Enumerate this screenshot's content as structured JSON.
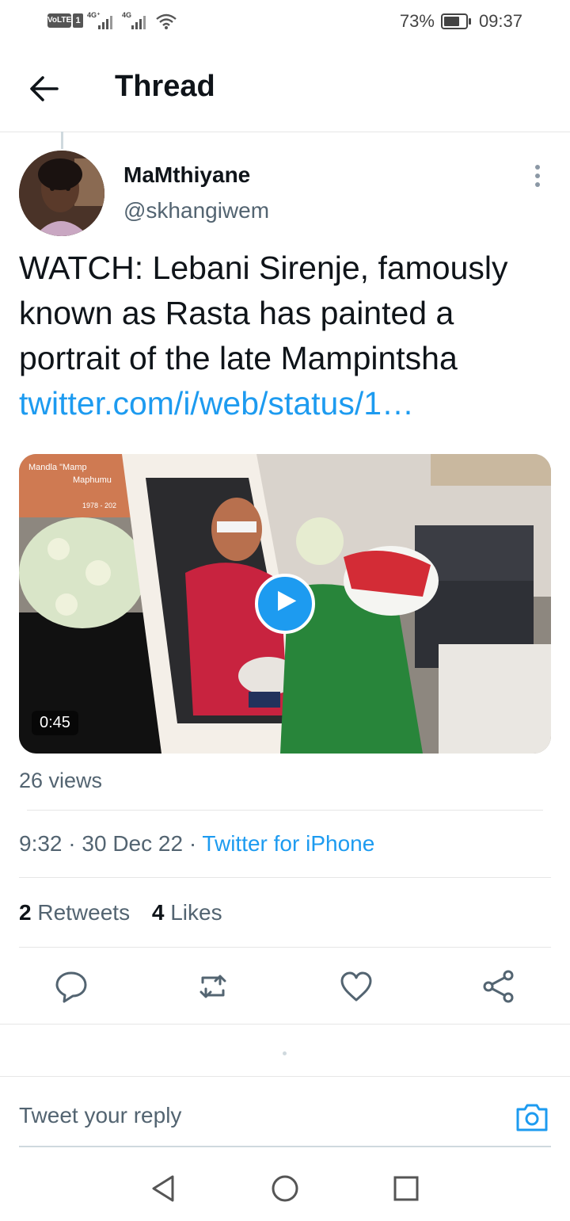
{
  "status_bar": {
    "volte": "VoLTE",
    "sim": "1",
    "network1": "4G⁺",
    "network2": "4G",
    "battery": "73%",
    "time": "09:37"
  },
  "header": {
    "title": "Thread",
    "back_icon": "arrow-left-icon"
  },
  "tweet": {
    "display_name": "MaMthiyane",
    "handle": "@skhangiwem",
    "text": "WATCH: Lebani Sirenje, famously known as Rasta has painted a portrait of the late Mampintsha",
    "link": "twitter.com/i/web/status/1…",
    "video": {
      "duration": "0:45",
      "banner_line1": "Mandla \"Mamp",
      "banner_line2": "Maphumu",
      "banner_line3": "1978 - 202",
      "play_icon": "play-icon"
    },
    "views": "26 views",
    "time": "9:32",
    "date": "30 Dec 22",
    "source": "Twitter for iPhone",
    "retweets_count": "2",
    "retweets_label": "Retweets",
    "likes_count": "4",
    "likes_label": "Likes"
  },
  "actions": [
    "reply-icon",
    "retweet-icon",
    "like-icon",
    "share-icon"
  ],
  "reply": {
    "placeholder": "Tweet your reply",
    "camera_icon": "camera-icon"
  },
  "nav": [
    "back-triangle-icon",
    "home-circle-icon",
    "recents-square-icon"
  ],
  "colors": {
    "accent": "#1d9bf0",
    "text": "#0f1419",
    "secondary": "#536471"
  }
}
